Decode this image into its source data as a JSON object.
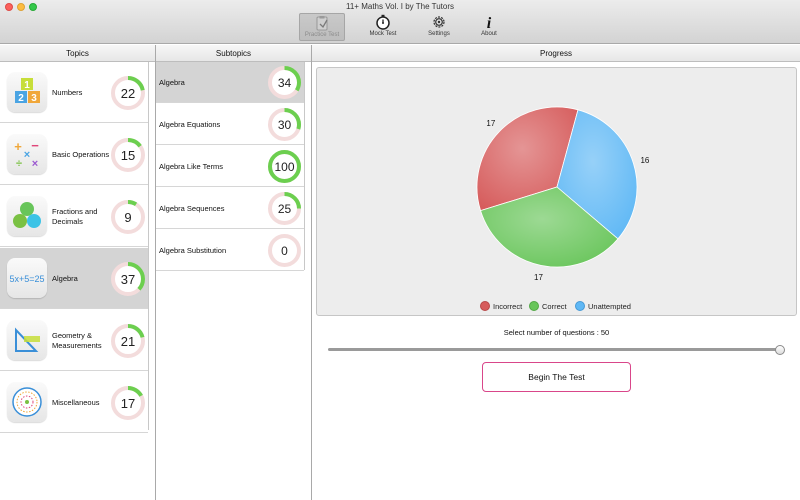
{
  "window": {
    "title": "11+ Maths Vol. I by The Tutors"
  },
  "toolbar": {
    "practice_test": "Practice Test",
    "mock_test": "Mock Test",
    "settings": "Settings",
    "about": "About"
  },
  "columns": {
    "topics": "Topics",
    "subtopics": "Subtopics",
    "progress": "Progress"
  },
  "topics": [
    {
      "label": "Numbers",
      "value": "22",
      "percent": 22,
      "icon": "numbers-icon"
    },
    {
      "label": "Basic Operations",
      "value": "15",
      "percent": 15,
      "icon": "basic-operations-icon"
    },
    {
      "label": "Fractions and Decimals",
      "value": "9",
      "percent": 9,
      "icon": "fractions-icon"
    },
    {
      "label": "Algebra",
      "value": "37",
      "percent": 37,
      "icon": "algebra-icon",
      "selected": true
    },
    {
      "label": "Geometry & Measurements",
      "value": "21",
      "percent": 21,
      "icon": "geometry-icon"
    },
    {
      "label": "Miscellaneous",
      "value": "17",
      "percent": 17,
      "icon": "miscellaneous-icon"
    }
  ],
  "subtopics": [
    {
      "label": "Algebra",
      "value": "34",
      "percent": 34,
      "selected": true
    },
    {
      "label": "Algebra Equations",
      "value": "30",
      "percent": 30
    },
    {
      "label": "Algebra Like Terms",
      "value": "100",
      "percent": 100
    },
    {
      "label": "Algebra Sequences",
      "value": "25",
      "percent": 25
    },
    {
      "label": "Algebra Substitution",
      "value": "0",
      "percent": 0
    }
  ],
  "chart_data": {
    "type": "pie",
    "slices": [
      {
        "label": "Incorrect",
        "value": 17,
        "color": "#d65c5c"
      },
      {
        "label": "Unattempted",
        "value": 16,
        "color": "#5fb8f5"
      },
      {
        "label": "Correct",
        "value": 17,
        "color": "#68c55a"
      }
    ],
    "data_labels": [
      "17",
      "16",
      "17"
    ],
    "legend": [
      "Incorrect",
      "Correct",
      "Unattempted"
    ],
    "legend_placement": "bottom"
  },
  "legend": {
    "incorrect": "Incorrect",
    "correct": "Correct",
    "unattempted": "Unattempted"
  },
  "questions": {
    "label": "Select number of questions : 50",
    "value": 50,
    "fraction": 1.0
  },
  "begin_button": "Begin The Test",
  "colors": {
    "ring_fill": "#6ccf4f",
    "ring_track": "#f3dcdc",
    "begin_border": "#d9468a",
    "selected_row": "#d4d4d4"
  }
}
